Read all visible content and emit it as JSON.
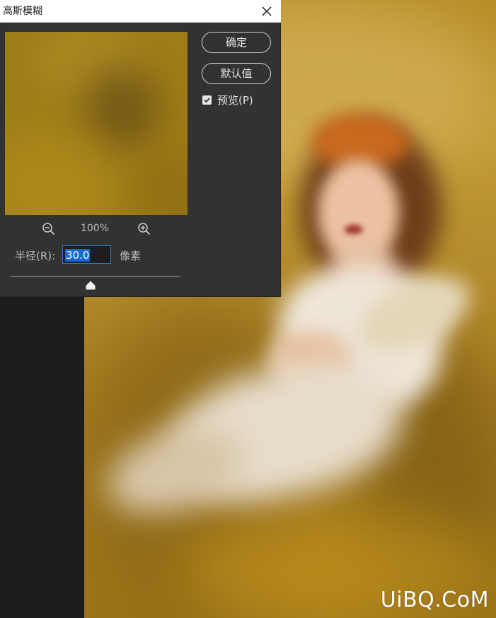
{
  "dialog": {
    "title": "高斯模糊",
    "ok_label": "确定",
    "default_label": "默认值",
    "preview_label": "预览(P)",
    "preview_checked": true,
    "zoom_level": "100%",
    "radius_label": "半径(R):",
    "radius_value": "30.0",
    "unit_label": "像素",
    "slider_fraction": 0.47
  },
  "icons": {
    "close": "close-icon",
    "zoom_out": "zoom-out-icon",
    "zoom_in": "zoom-in-icon",
    "checkmark": "checkmark-icon",
    "slider_thumb": "slider-thumb-icon"
  },
  "canvas": {
    "watermark": "UiBQ.CoM"
  },
  "colors": {
    "dialog_bg": "#323232",
    "titlebar_bg": "#ffffff",
    "selection": "#1a68d3",
    "input_border": "#2e7bcf",
    "preview_tint": "#9e7d17"
  }
}
